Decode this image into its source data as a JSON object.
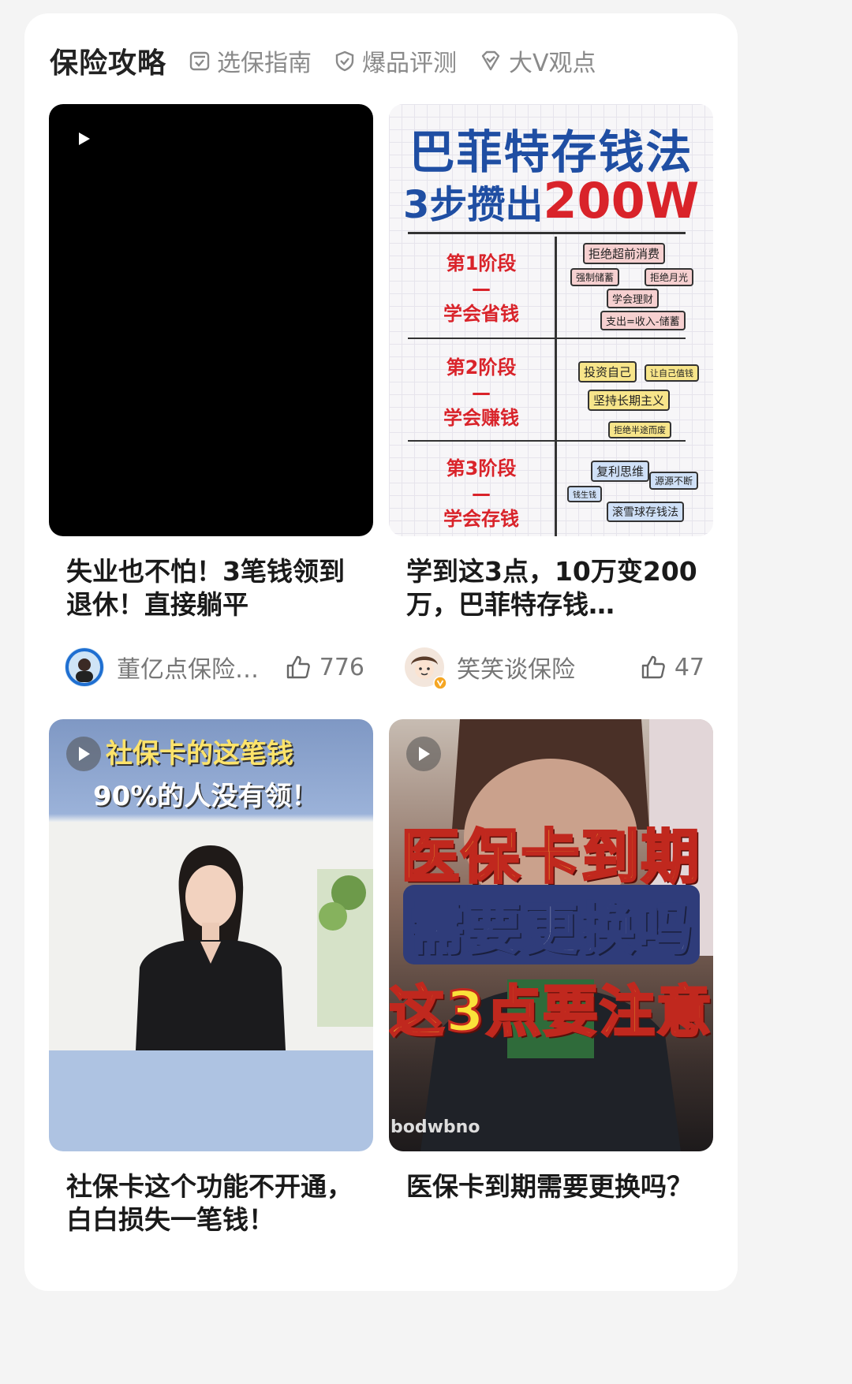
{
  "header": {
    "title": "保险攻略",
    "tabs": [
      {
        "label": "选保指南",
        "icon": "checklist-icon"
      },
      {
        "label": "爆品评测",
        "icon": "shield-check-icon"
      },
      {
        "label": "大V观点",
        "icon": "heart-check-icon"
      }
    ]
  },
  "items": [
    {
      "title": "失业也不怕！3笔钱领到退休！直接躺平",
      "author": "董亿点保险…",
      "likes": "776",
      "thumb": {
        "type": "video-black"
      }
    },
    {
      "title": "学到这3点，10万变200万，巴菲特存钱…",
      "author": "笑笑谈保险",
      "likes": "47",
      "thumb": {
        "heading1": "巴菲特存钱法",
        "heading2_prefix": "3步攒出",
        "heading2_highlight": "200W",
        "stages": [
          {
            "name": "第1阶段",
            "dash": "—",
            "goal": "学会省钱",
            "tags": [
              "拒绝超前消费",
              "强制储蓄",
              "拒绝月光",
              "学会理财",
              "支出=收入-储蓄"
            ]
          },
          {
            "name": "第2阶段",
            "dash": "—",
            "goal": "学会赚钱",
            "tags": [
              "投资自己",
              "让自己值钱",
              "坚持长期主义",
              "拒绝半途而废"
            ]
          },
          {
            "name": "第3阶段",
            "dash": "—",
            "goal": "学会存钱",
            "tags": [
              "复利思维",
              "源源不断",
              "钱生钱",
              "滚雪球存钱法"
            ]
          }
        ]
      }
    },
    {
      "title": "社保卡这个功能不开通，白白损失一笔钱！",
      "thumb": {
        "caption1": "社保卡的这笔钱",
        "caption2": "90%的人没有领！"
      }
    },
    {
      "title": "医保卡到期需要更换吗？",
      "thumb": {
        "line1": "医保卡到期",
        "line2": "需要更换吗",
        "line3": "这3点要注意",
        "brand": "bodwbno"
      }
    }
  ]
}
